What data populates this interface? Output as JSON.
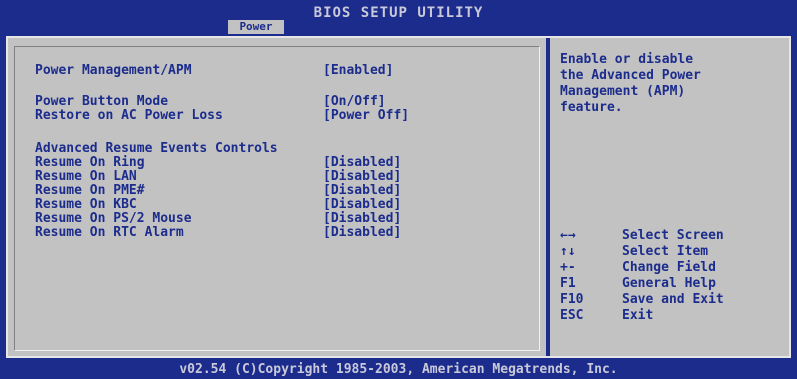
{
  "header": {
    "title": "BIOS SETUP UTILITY",
    "active_tab": "Power"
  },
  "settings": [
    {
      "label": "Power Management/APM",
      "value": "[Enabled]"
    },
    {
      "label": "Power Button Mode",
      "value": "[On/Off]"
    },
    {
      "label": "Restore on AC Power Loss",
      "value": "[Power Off]"
    },
    {
      "label": "Advanced Resume Events Controls",
      "value": ""
    },
    {
      "label": "Resume On Ring",
      "value": "[Disabled]"
    },
    {
      "label": "Resume On LAN",
      "value": "[Disabled]"
    },
    {
      "label": "Resume On PME#",
      "value": "[Disabled]"
    },
    {
      "label": "Resume On KBC",
      "value": "[Disabled]"
    },
    {
      "label": "Resume On PS/2 Mouse",
      "value": "[Disabled]"
    },
    {
      "label": "Resume On RTC Alarm",
      "value": "[Disabled]"
    }
  ],
  "help": {
    "text": "Enable or disable\nthe Advanced Power\nManagement (APM)\nfeature."
  },
  "keys": [
    {
      "key": "←→",
      "desc": "Select Screen"
    },
    {
      "key": "↑↓",
      "desc": "Select Item"
    },
    {
      "key": "+-",
      "desc": "Change Field"
    },
    {
      "key": "F1",
      "desc": "General Help"
    },
    {
      "key": "F10",
      "desc": "Save and Exit"
    },
    {
      "key": "ESC",
      "desc": "Exit"
    }
  ],
  "footer": "v02.54 (C)Copyright 1985-2003, American Megatrends, Inc.",
  "colors": {
    "background": "#1c2c8c",
    "panel": "#c2c2c2",
    "text": "#1c2c8c",
    "header_text": "#c9c9d9"
  }
}
